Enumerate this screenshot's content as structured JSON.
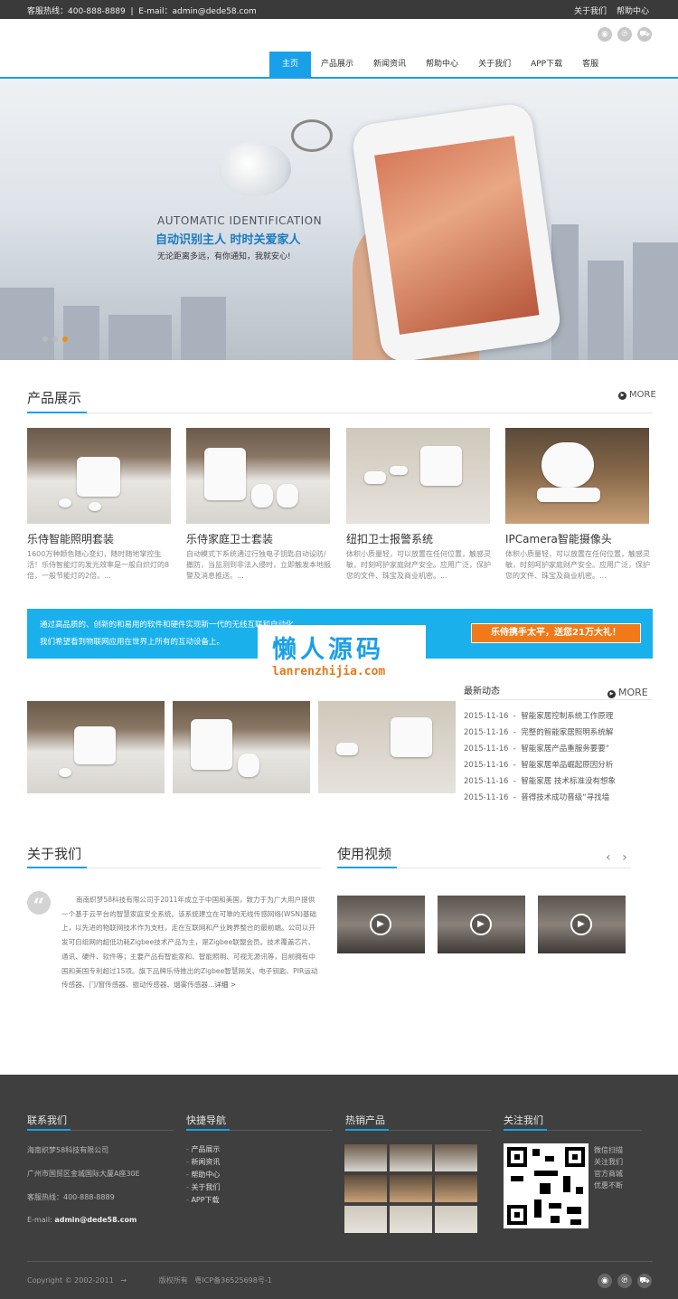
{
  "topbar": {
    "hotline": "客服热线：400-888-8889",
    "sep": "|",
    "email": "E-mail：admin@dede58.com",
    "about": "关于我们",
    "help": "帮助中心"
  },
  "header_icons": [
    "weibo-icon",
    "pinterest-icon",
    "cart-icon"
  ],
  "nav": {
    "items": [
      "主页",
      "产品展示",
      "新闻资讯",
      "帮助中心",
      "关于我们",
      "APP下载",
      "客服"
    ]
  },
  "banner": {
    "en": "AUTOMATIC IDENTIFICATION",
    "cn": "自动识别主人  时时关爱家人",
    "sub": "无论距离多远，有你通知，我就安心!",
    "slides": 3,
    "active_slide": 3
  },
  "products": {
    "title": "产品展示",
    "more": "MORE",
    "items": [
      {
        "title": "乐侍智能照明套装",
        "desc": "1600万种颜色随心变幻，随时随地掌控生活！乐侍智能灯的发光效率是一般白炽灯的8倍，一般节能灯的2倍。..."
      },
      {
        "title": "乐侍家庭卫士套装",
        "desc": "自动模式下系统通过行独电子钥匙自动设防/撤防，当监测到非法入侵时，立即触发本地报警及消息推送。..."
      },
      {
        "title": "纽扣卫士报警系统",
        "desc": "体积小质量轻，可以放置在任何位置，触感灵敏，时刻呵护家庭财产安全。应用广泛，保护您的文件、珠宝及商业机密。..."
      },
      {
        "title": "IPCamera智能摄像头",
        "desc": "体积小质量轻，可以放置在任何位置，触感灵敏，时刻呵护家庭财产安全。应用广泛，保护您的文件、珠宝及商业机密。..."
      }
    ]
  },
  "strip": {
    "line1": "通过高品质的、创新的和易用的软件和硬件实现新一代的无线互联和自动化",
    "line2": "我们希望看到物联网应用在世界上所有的互动设备上。",
    "button": "乐侍携手太平，送您21万大礼！"
  },
  "watermark": {
    "cn": "懒人源码",
    "en": "lanrenzhijia.com"
  },
  "news": {
    "title": "最新动态",
    "more": "MORE",
    "items": [
      {
        "date": "2015-11-16",
        "text": "智能家居控制系统工作原理"
      },
      {
        "date": "2015-11-16",
        "text": "完整的智能家居照明系统解"
      },
      {
        "date": "2015-11-16",
        "text": "智能家居产品重服务要要“"
      },
      {
        "date": "2015-11-16",
        "text": "智能家居单品崛起原因分析"
      },
      {
        "date": "2015-11-16",
        "text": "智能家居 技术标准没有想象"
      },
      {
        "date": "2015-11-16",
        "text": "普得技术成功晋级“寻找墙"
      }
    ]
  },
  "about": {
    "title": "关于我们",
    "text": "南南织梦58科技有限公司于2011年成立于中国和美国，致力于为广大用户提供一个基于云平台的智慧家庭安全系统。该系统建立在可靠的无线传感网络(WSN)基础上，以先进的物联网技术作为支柱，走在互联网和产业跨界整合的最前端。公司以开发可自组网的超低功耗Zigbee技术产品为主，是Zigbee联盟会员。技术覆盖芯片、通讯、硬件、软件等；主要产品有智能家和、智能照明、可视无源讯等，目前拥有中国和美国专利超过15项。旗下品牌乐侍推出的Zigbee智慧网关、电子钥匙、PIR运动传感器、门/窗传感器、振动传感器、烟雾传感器...",
    "detail": "详细 >"
  },
  "video": {
    "title": "使用视频",
    "prev": "‹",
    "next": "›"
  },
  "footer": {
    "contact": {
      "title": "联系我们",
      "company": "海南织梦58科技有限公司",
      "address": "广州市国贸区金城国际大厦A座30E",
      "hotline": "客服热线：400-888-8889",
      "email_label": "E-mail:",
      "email": "admin@dede58.com"
    },
    "quicknav": {
      "title": "快捷导航",
      "items": [
        "产品展示",
        "新闻资讯",
        "帮助中心",
        "关于我们",
        "APP下载"
      ]
    },
    "hot": {
      "title": "热销产品"
    },
    "follow": {
      "title": "关注我们",
      "lines": [
        "微信扫描",
        "关注我们",
        "官方商城",
        "优惠不断"
      ]
    },
    "copyright": "Copyright © 2002-2011",
    "rights": "版权所有",
    "icp": "粤ICP备36525698号-1"
  }
}
